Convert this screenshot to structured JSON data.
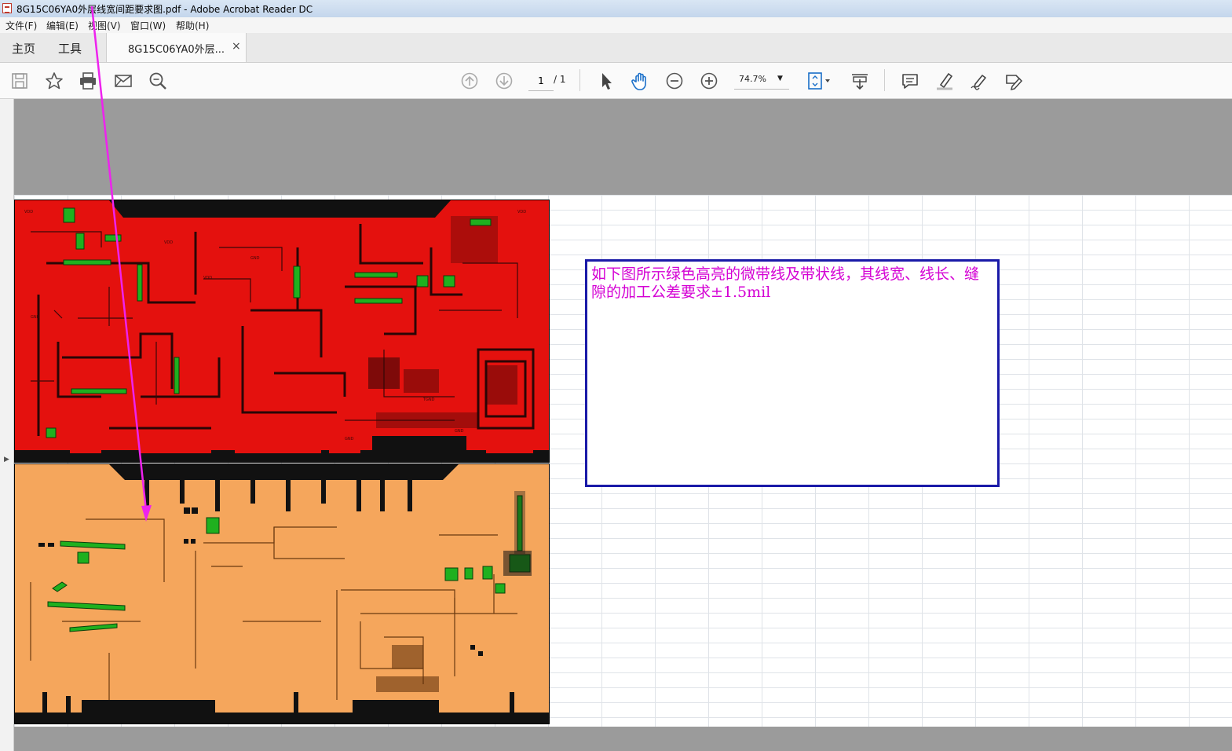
{
  "window": {
    "title": "8G15C06YA0外层线宽间距要求图.pdf - Adobe Acrobat Reader DC"
  },
  "menu": [
    "文件(F)",
    "编辑(E)",
    "视图(V)",
    "窗口(W)",
    "帮助(H)"
  ],
  "tabs": {
    "home": "主页",
    "tools": "工具",
    "document": "8G15C06YA0外层...",
    "close": "×"
  },
  "toolbar": {
    "icons": [
      "save-icon",
      "star-icon",
      "print-icon",
      "mail-icon",
      "search-zoom-icon",
      "page-up-icon",
      "page-down-icon",
      "select-cursor-icon",
      "hand-icon",
      "zoom-out-icon",
      "zoom-in-icon",
      "fit-page-icon",
      "scroll-mode-icon",
      "comment-icon",
      "highlight-icon",
      "sign-icon",
      "fill-sign-icon"
    ],
    "page_current": "1",
    "page_total": "/ 1",
    "zoom": "74.7%"
  },
  "document": {
    "note": "如下图所示绿色高亮的微带线及带状线，其线宽、线长、缝隙的加工公差要求±1.5mil",
    "colors": {
      "top_layer": "#e4110e",
      "bottom_layer": "#f5a65c",
      "highlight": "#1fb01f",
      "note_text": "#d400d4",
      "note_border": "#1a1aa8",
      "arrow": "#ee22ee"
    }
  }
}
